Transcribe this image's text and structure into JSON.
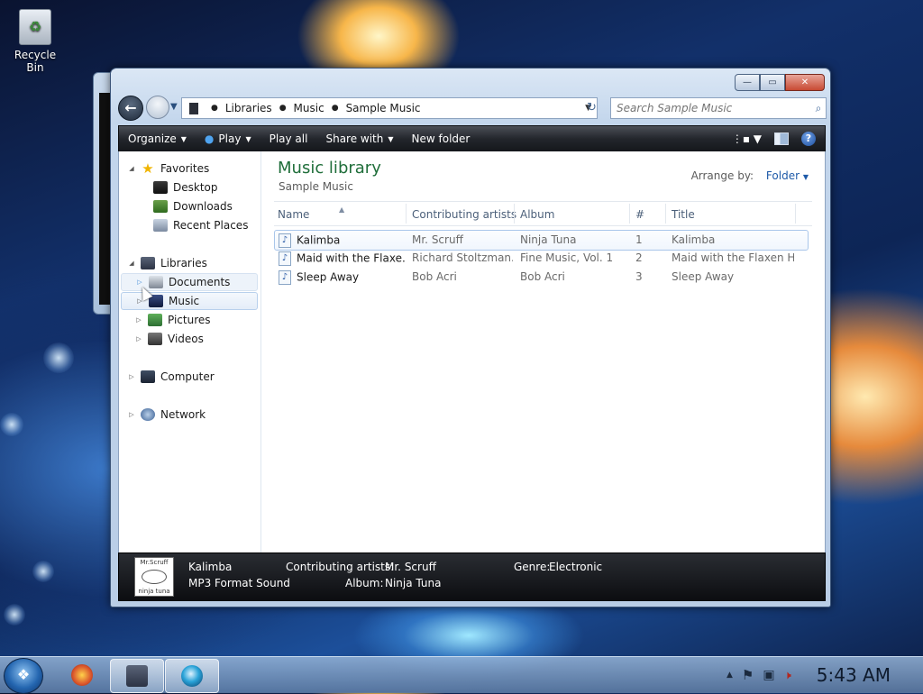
{
  "desktop": {
    "recycle_bin_label": "Recycle Bin"
  },
  "window": {
    "controls": {
      "minimize": "—",
      "maximize": "▭",
      "close": "✕"
    },
    "address": {
      "crumbs": [
        "Libraries",
        "Music",
        "Sample Music"
      ],
      "search_placeholder": "Search Sample Music"
    },
    "toolbar": {
      "organize": "Organize",
      "play": "Play",
      "play_all": "Play all",
      "share_with": "Share with",
      "new_folder": "New folder",
      "help": "?"
    },
    "navpane": {
      "favorites": "Favorites",
      "desktop": "Desktop",
      "downloads": "Downloads",
      "recent_places": "Recent Places",
      "libraries": "Libraries",
      "documents": "Documents",
      "music": "Music",
      "pictures": "Pictures",
      "videos": "Videos",
      "computer": "Computer",
      "network": "Network"
    },
    "main": {
      "title": "Music library",
      "subtitle": "Sample Music",
      "arrange_label": "Arrange by:",
      "arrange_value": "Folder",
      "columns": {
        "name": "Name",
        "artists": "Contributing artists",
        "album": "Album",
        "track": "#",
        "title": "Title"
      },
      "rows": [
        {
          "name": "Kalimba",
          "artists": "Mr. Scruff",
          "album": "Ninja Tuna",
          "track": "1",
          "title": "Kalimba"
        },
        {
          "name": "Maid with the Flaxe...",
          "artists": "Richard Stoltzman...",
          "album": "Fine Music, Vol. 1",
          "track": "2",
          "title": "Maid with the Flaxen H..."
        },
        {
          "name": "Sleep Away",
          "artists": "Bob Acri",
          "album": "Bob Acri",
          "track": "3",
          "title": "Sleep Away"
        }
      ]
    },
    "details": {
      "thumb_text_top": "Mr.Scruff",
      "thumb_text_bottom": "ninja tuna",
      "name": "Kalimba",
      "type": "MP3 Format Sound",
      "artists_label": "Contributing artists:",
      "artists_value": "Mr. Scruff",
      "album_label": "Album:",
      "album_value": "Ninja Tuna",
      "genre_label": "Genre:",
      "genre_value": "Electronic"
    }
  },
  "taskbar": {
    "clock": "5:43 AM"
  }
}
